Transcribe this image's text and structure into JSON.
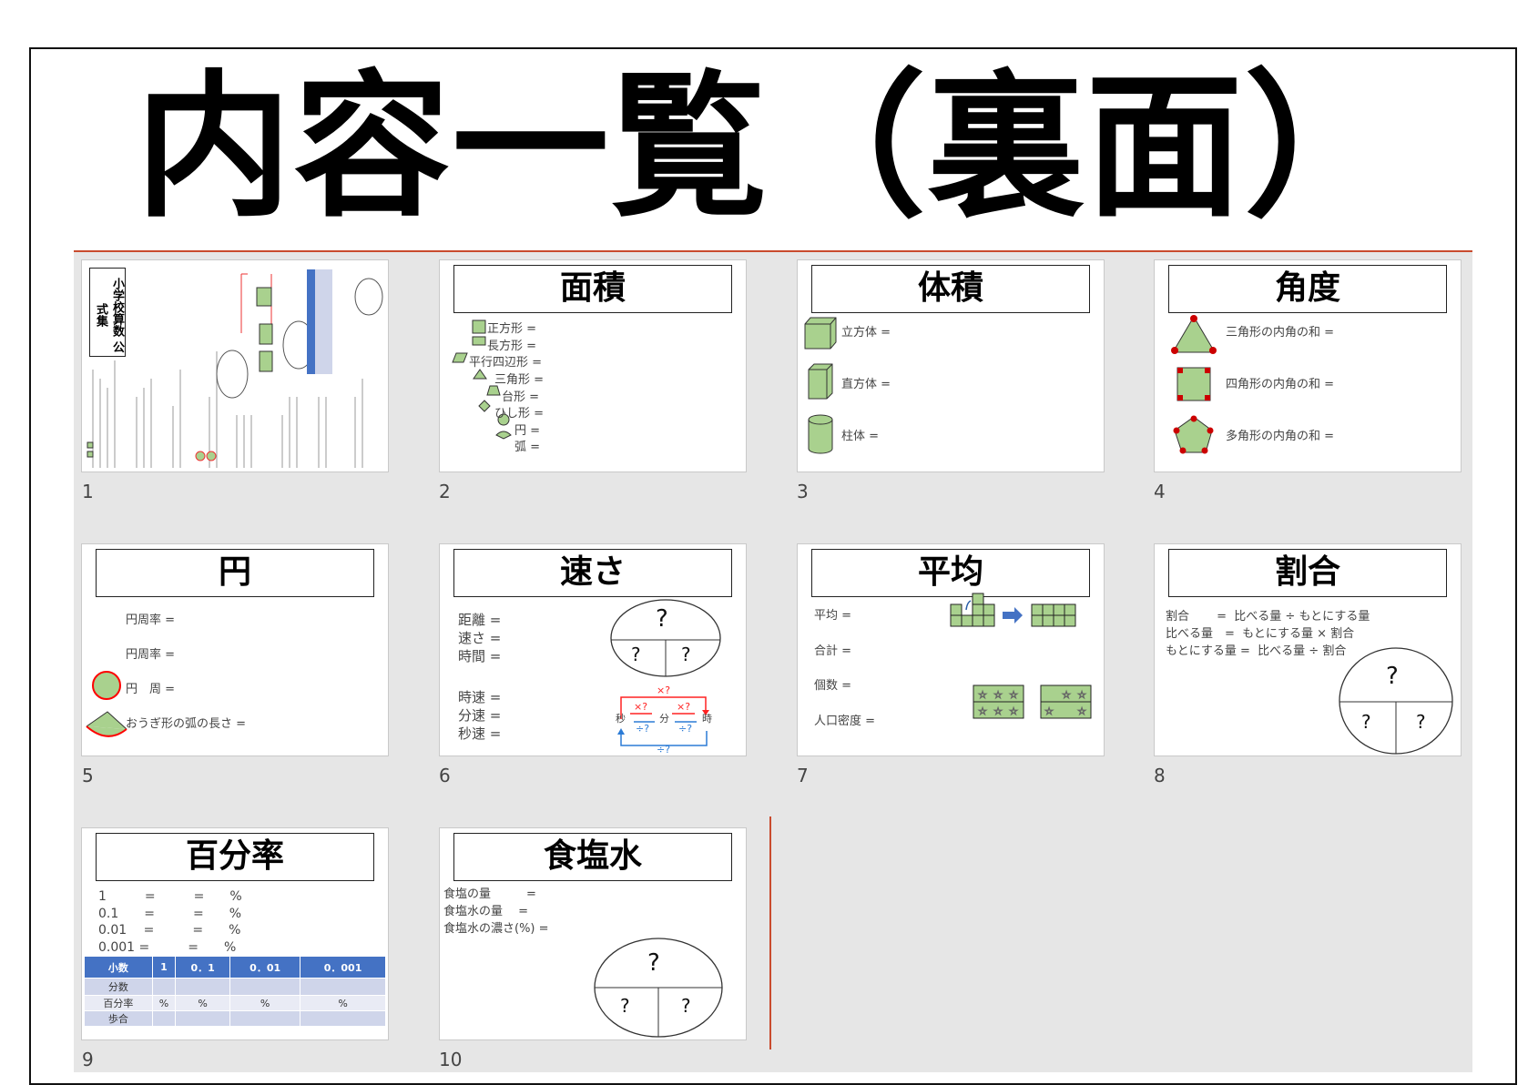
{
  "title": "内容一覧（裏面）",
  "slides": [
    {
      "num": "1",
      "title": "小学校算数 公式集"
    },
    {
      "num": "2",
      "title": "面積",
      "items": [
        "正方形 =",
        "長方形 =",
        "平行四辺形 =",
        "三角形 =",
        "台形 =",
        "ひし形 =",
        "円 =",
        "弧 ="
      ]
    },
    {
      "num": "3",
      "title": "体積",
      "items": [
        "立方体 =",
        "直方体 =",
        "柱体 ="
      ]
    },
    {
      "num": "4",
      "title": "角度",
      "items": [
        "三角形の内角の和 =",
        "四角形の内角の和 =",
        "多角形の内角の和 ="
      ]
    },
    {
      "num": "5",
      "title": "円",
      "items": [
        "円周率 =",
        "円周率 =",
        "円　周 =",
        "おうぎ形の弧の長さ ="
      ]
    },
    {
      "num": "6",
      "title": "速さ",
      "items": [
        "距離 =",
        "速さ =",
        "時間 =",
        "時速 =",
        "分速 =",
        "秒速 ="
      ],
      "q": "?",
      "units": [
        "秒",
        "分",
        "時"
      ],
      "mul": "×?",
      "div": "÷?"
    },
    {
      "num": "7",
      "title": "平均",
      "items": [
        "平均 =",
        "合計 =",
        "個数 =",
        "人口密度 ="
      ]
    },
    {
      "num": "8",
      "title": "割合",
      "items": [
        "割合　　 =  比べる量 ÷ もとにする量",
        "比べる量　=  もとにする量 × 割合",
        "もとにする量 =  比べる量 ÷ 割合"
      ],
      "q": "?"
    },
    {
      "num": "9",
      "title": "百分率",
      "items": [
        "1　　　=　　　=　　%",
        "0.1　　=　　　=　　%",
        "0.01　 =　　　=　　%",
        "0.001 =　　　=　　%"
      ],
      "table": {
        "rows": [
          [
            "小数",
            "1",
            "0．1",
            "0．01",
            "0．001"
          ],
          [
            "分数",
            "",
            "",
            "",
            ""
          ],
          [
            "百分率",
            "%",
            "%",
            "%",
            "%"
          ],
          [
            "歩合",
            "",
            "",
            "",
            ""
          ]
        ]
      }
    },
    {
      "num": "10",
      "title": "食塩水",
      "items": [
        "食塩の量　　　=",
        "食塩水の量　 =",
        "食塩水の濃さ(%) ="
      ],
      "q": "?"
    }
  ],
  "colors": {
    "accent": "#c94b2e",
    "shape_fill": "#a9d18e",
    "table_header": "#4472c4"
  }
}
